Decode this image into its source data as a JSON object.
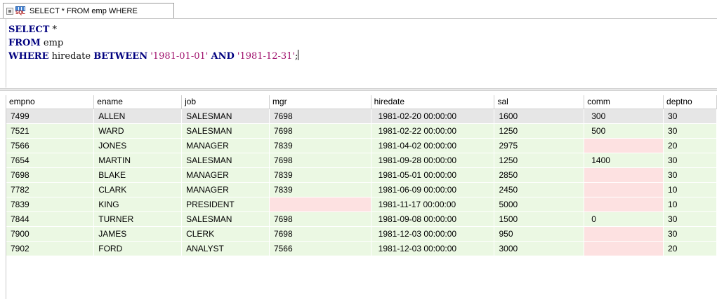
{
  "tab": {
    "title": "SELECT * FROM emp WHERE",
    "sql_badge": "SQL"
  },
  "editor": {
    "lines": [
      [
        {
          "t": "SELECT",
          "c": "kw"
        },
        {
          "t": " *",
          "c": "id"
        }
      ],
      [
        {
          "t": "FROM",
          "c": "kw"
        },
        {
          "t": " emp",
          "c": "id"
        }
      ],
      [
        {
          "t": "WHERE",
          "c": "kw"
        },
        {
          "t": " hiredate ",
          "c": "id"
        },
        {
          "t": "BETWEEN",
          "c": "kw"
        },
        {
          "t": " ",
          "c": "id"
        },
        {
          "t": "'1981-01-01'",
          "c": "str"
        },
        {
          "t": " ",
          "c": "id"
        },
        {
          "t": "AND",
          "c": "kw"
        },
        {
          "t": " ",
          "c": "id"
        },
        {
          "t": "'1981-12-31'",
          "c": "str"
        },
        {
          "t": ";",
          "c": "id"
        }
      ]
    ]
  },
  "results": {
    "columns": [
      "empno",
      "ename",
      "job",
      "mgr",
      "hiredate",
      "sal",
      "comm",
      "deptno"
    ],
    "rows": [
      [
        "7499",
        "ALLEN",
        "SALESMAN",
        "7698",
        "1981-02-20 00:00:00",
        "1600",
        "300",
        "30"
      ],
      [
        "7521",
        "WARD",
        "SALESMAN",
        "7698",
        "1981-02-22 00:00:00",
        "1250",
        "500",
        "30"
      ],
      [
        "7566",
        "JONES",
        "MANAGER",
        "7839",
        "1981-04-02 00:00:00",
        "2975",
        null,
        "20"
      ],
      [
        "7654",
        "MARTIN",
        "SALESMAN",
        "7698",
        "1981-09-28 00:00:00",
        "1250",
        "1400",
        "30"
      ],
      [
        "7698",
        "BLAKE",
        "MANAGER",
        "7839",
        "1981-05-01 00:00:00",
        "2850",
        null,
        "30"
      ],
      [
        "7782",
        "CLARK",
        "MANAGER",
        "7839",
        "1981-06-09 00:00:00",
        "2450",
        null,
        "10"
      ],
      [
        "7839",
        "KING",
        "PRESIDENT",
        null,
        "1981-11-17 00:00:00",
        "5000",
        null,
        "10"
      ],
      [
        "7844",
        "TURNER",
        "SALESMAN",
        "7698",
        "1981-09-08 00:00:00",
        "1500",
        "0",
        "30"
      ],
      [
        "7900",
        "JAMES",
        "CLERK",
        "7698",
        "1981-12-03 00:00:00",
        "950",
        null,
        "30"
      ],
      [
        "7902",
        "FORD",
        "ANALYST",
        "7566",
        "1981-12-03 00:00:00",
        "3000",
        null,
        "20"
      ]
    ],
    "selected_row": 0
  }
}
